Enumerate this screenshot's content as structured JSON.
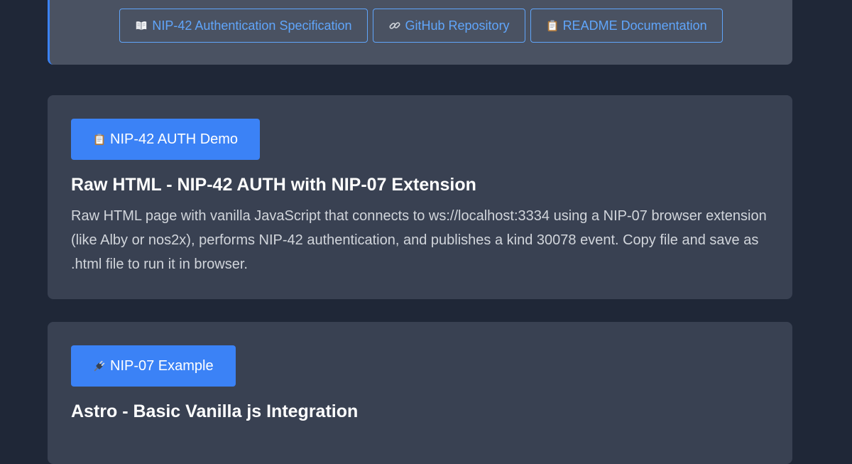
{
  "resource_links": [
    {
      "icon": "open-book-icon",
      "label": "NIP-42 Authentication Specification"
    },
    {
      "icon": "link-icon",
      "label": "GitHub Repository"
    },
    {
      "icon": "clipboard-icon",
      "label": "README Documentation"
    }
  ],
  "examples": [
    {
      "badge_icon": "clipboard-icon",
      "badge_label": "NIP-42 AUTH Demo",
      "title": "Raw HTML - NIP-42 AUTH with NIP-07 Extension",
      "description": "Raw HTML page with vanilla JavaScript that connects to ws://localhost:3334 using a NIP-07 browser extension (like Alby or nos2x), performs NIP-42 authentication, and publishes a kind 30078 event. Copy file and save as .html file to run it in browser."
    },
    {
      "badge_icon": "plug-icon",
      "badge_label": "NIP-07 Example",
      "title": "Astro - Basic Vanilla js Integration"
    }
  ],
  "colors": {
    "background": "#1f2737",
    "card": "#394152",
    "links_card": "#4a5262",
    "accent": "#3b82f6",
    "link": "#60a5fa"
  }
}
